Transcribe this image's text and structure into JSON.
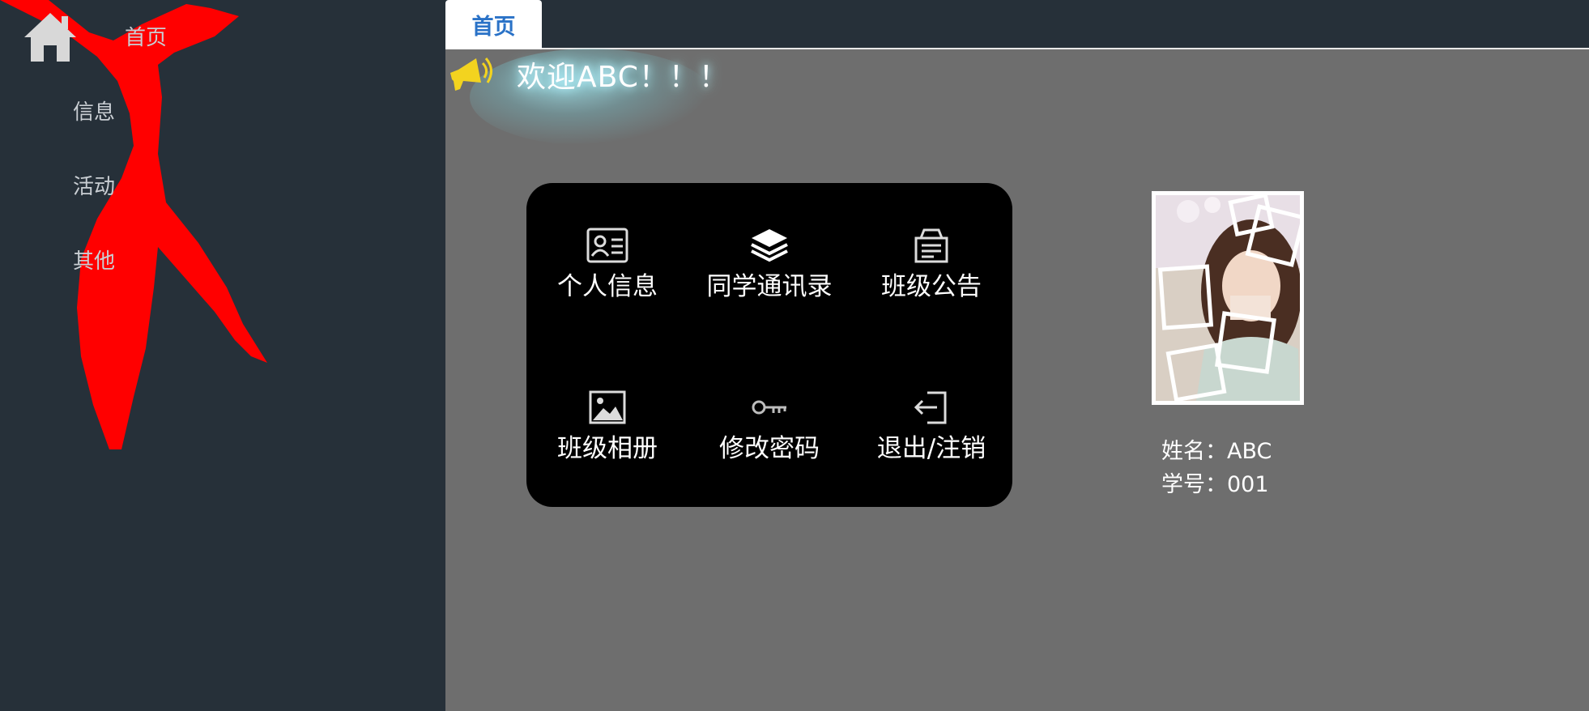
{
  "sidebar": {
    "logo_icon": "home-icon",
    "items": [
      {
        "label": "首页"
      },
      {
        "label": "信息"
      },
      {
        "label": "活动"
      },
      {
        "label": "其他"
      }
    ]
  },
  "tabs": [
    {
      "label": "首页",
      "active": true
    }
  ],
  "welcome": {
    "icon": "megaphone-icon",
    "text": "欢迎ABC！！！"
  },
  "menu": {
    "items": [
      {
        "label": "个人信息",
        "icon": "id-card-icon"
      },
      {
        "label": "同学通讯录",
        "icon": "layers-icon"
      },
      {
        "label": "班级公告",
        "icon": "notice-board-icon"
      },
      {
        "label": "班级相册",
        "icon": "picture-icon"
      },
      {
        "label": "修改密码",
        "icon": "key-icon"
      },
      {
        "label": "退出/注销",
        "icon": "logout-icon"
      }
    ]
  },
  "profile": {
    "name_line": "姓名：ABC",
    "id_line": "学号：001"
  },
  "colors": {
    "sidebar_bg": "#263039",
    "content_bg": "#6e6e6e",
    "panel_bg": "#000000",
    "tab_text": "#2a72c7",
    "scarf": "#ff0000"
  }
}
